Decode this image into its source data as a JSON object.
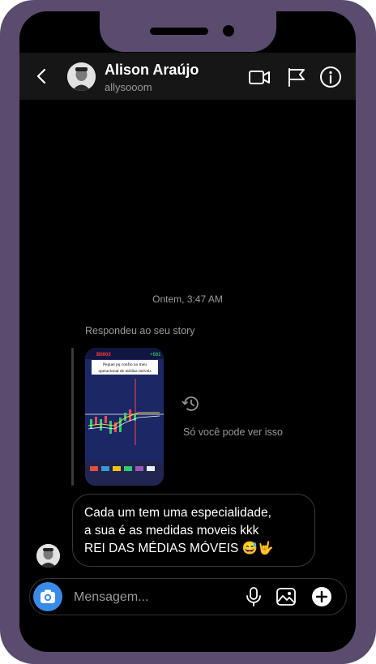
{
  "header": {
    "back_icon": "chevron-left-icon",
    "name": "Alison Araújo",
    "username": "allysooom",
    "video_icon": "video-camera-icon",
    "flag_icon": "flag-icon",
    "info_icon": "info-icon"
  },
  "thread": {
    "timestamp": "Ontem, 3:47 AM",
    "story_reply_label": "Respondeu ao seu story",
    "story": {
      "caption_line1": "Peguei pq confio no meu",
      "caption_line2": "operacional de médias móveis",
      "price_badge": "+681"
    },
    "visibility_note": "Só você pode ver isso",
    "message": {
      "line1": "Cada um tem uma especialidade,",
      "line2": "a sua é as medidas moveis kkk",
      "line3": "REI DAS MÉDIAS MÓVEIS 😅🤟"
    }
  },
  "composer": {
    "placeholder": "Mensagem...",
    "camera_icon": "camera-icon",
    "mic_icon": "microphone-icon",
    "gallery_icon": "gallery-icon",
    "add_icon": "plus-circle-icon"
  },
  "colors": {
    "frame": "#5a4c6e",
    "screen": "#000000",
    "header": "#161616",
    "accent": "#3a8be8",
    "muted_text": "#9a9a9a"
  }
}
